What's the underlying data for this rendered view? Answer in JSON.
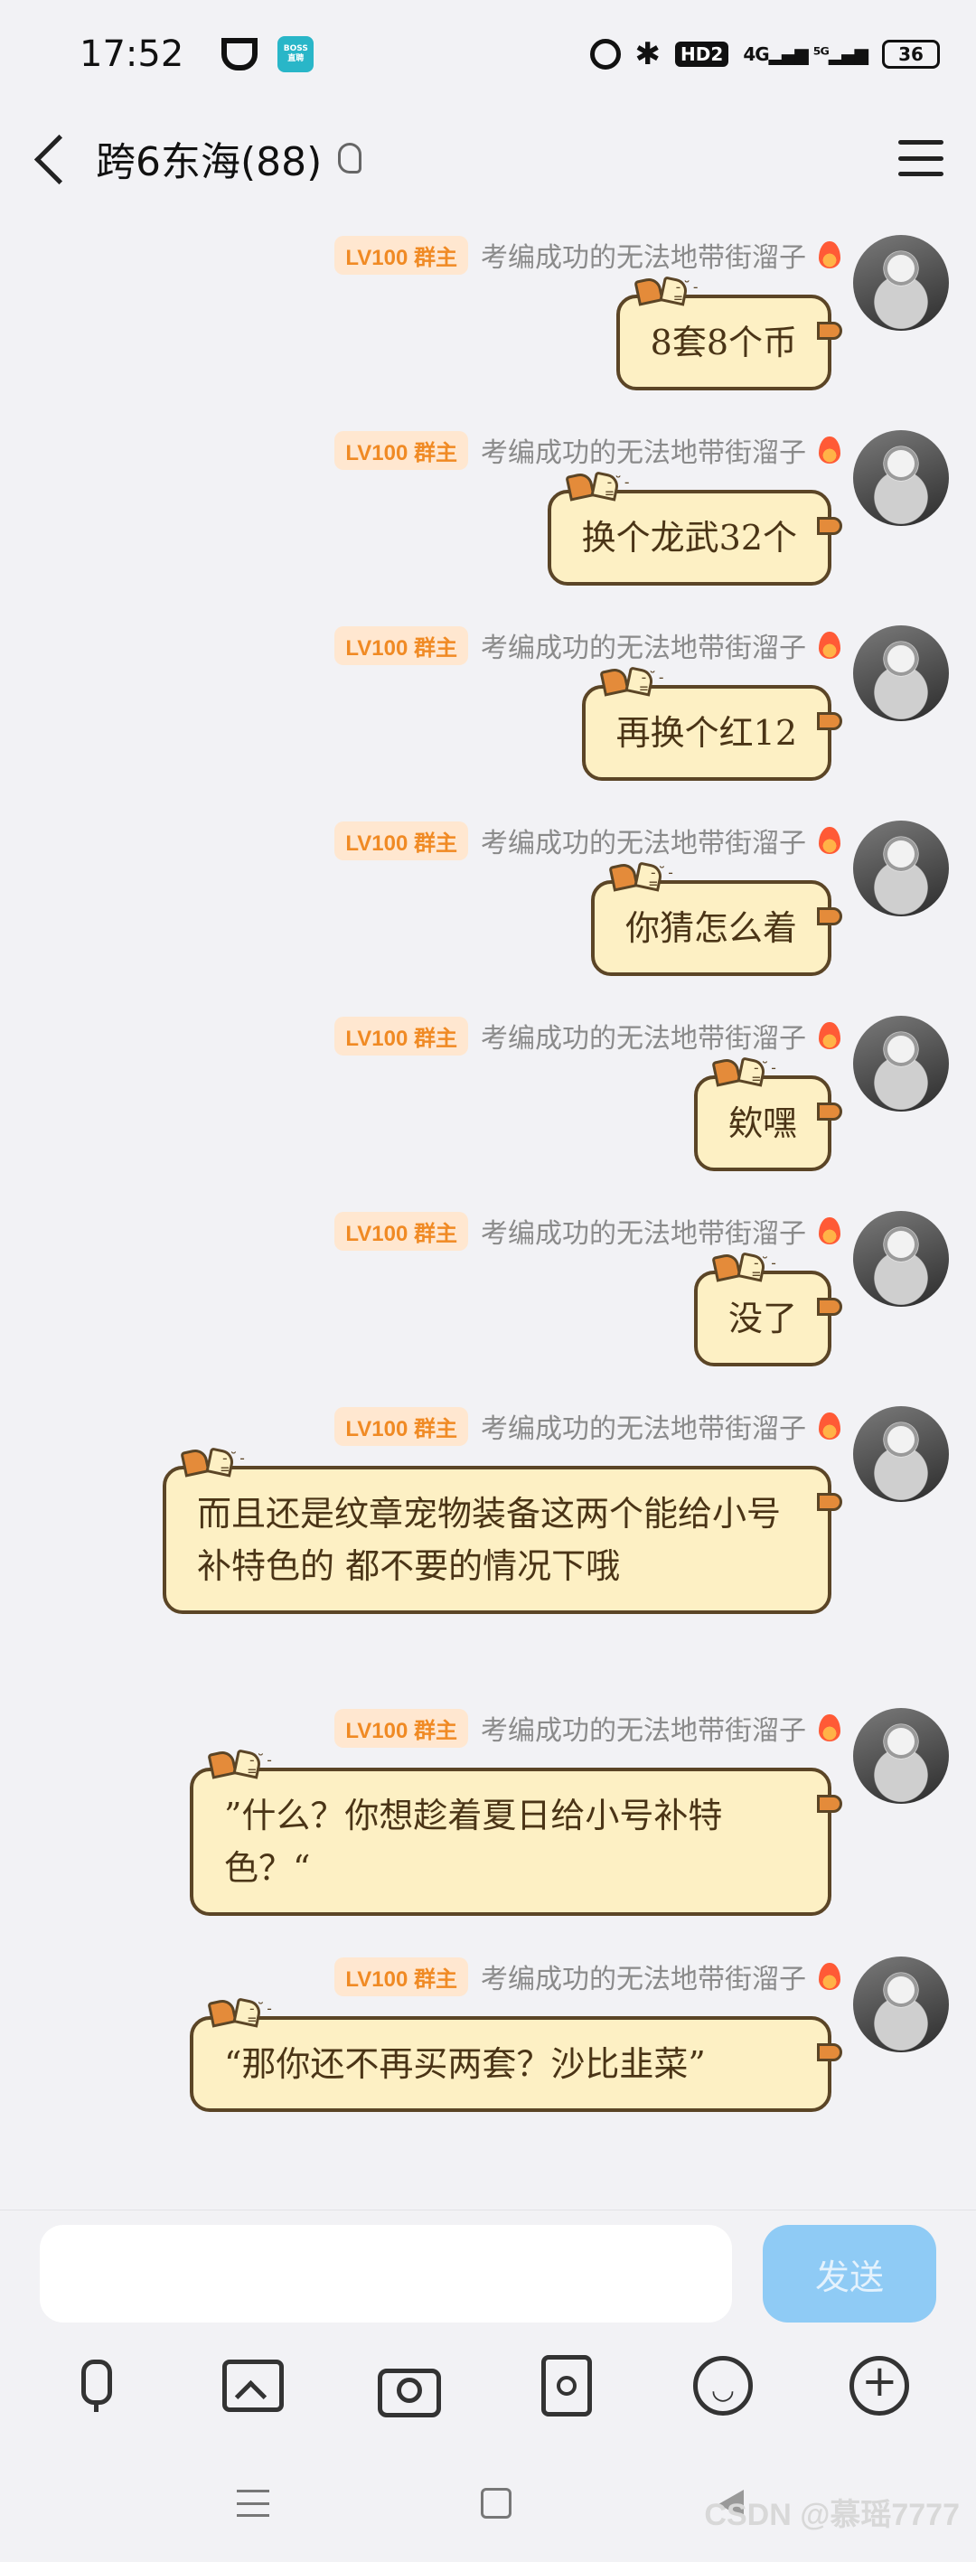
{
  "status_bar": {
    "time": "17:52",
    "boss_app": "BOSS\n直聘",
    "hd": "HD2",
    "signal": "4G ⁵ᴳ",
    "battery": "36"
  },
  "header": {
    "title": "跨6东海(88)"
  },
  "messages": [
    {
      "badge": "LV100 群主",
      "sender": "考编成功的无法地带街溜子",
      "text": "8套8个币"
    },
    {
      "badge": "LV100 群主",
      "sender": "考编成功的无法地带街溜子",
      "text": "换个龙武32个"
    },
    {
      "badge": "LV100 群主",
      "sender": "考编成功的无法地带街溜子",
      "text": "再换个红12"
    },
    {
      "badge": "LV100 群主",
      "sender": "考编成功的无法地带街溜子",
      "text": "你猜怎么着"
    },
    {
      "badge": "LV100 群主",
      "sender": "考编成功的无法地带街溜子",
      "text": "欸嘿"
    },
    {
      "badge": "LV100 群主",
      "sender": "考编成功的无法地带街溜子",
      "text": "没了"
    },
    {
      "badge": "LV100 群主",
      "sender": "考编成功的无法地带街溜子",
      "text": "而且还是纹章宠物装备这两个能给小号补特色的 都不要的情况下哦"
    },
    {
      "badge": "LV100 群主",
      "sender": "考编成功的无法地带街溜子",
      "text": "”什么？你想趁着夏日给小号补特色？“"
    },
    {
      "badge": "LV100 群主",
      "sender": "考编成功的无法地带街溜子",
      "text": "“那你还不再买两套？沙比韭菜”"
    }
  ],
  "input": {
    "value": "",
    "send_label": "发送"
  },
  "toolbar": {
    "icons": [
      "mic-icon",
      "image-icon",
      "camera-icon",
      "redpacket-icon",
      "emoji-icon",
      "plus-icon"
    ]
  },
  "watermark": "CSDN @慕瑶7777"
}
